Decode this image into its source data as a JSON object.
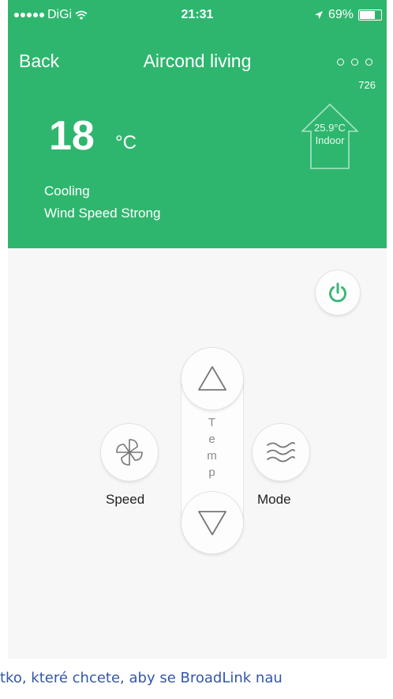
{
  "status_bar": {
    "carrier": "DiGi",
    "time": "21:31",
    "battery": "69%",
    "battery_level": 0.69
  },
  "nav": {
    "back_label": "Back",
    "title": "Aircond living",
    "device_id": "726"
  },
  "temperature": {
    "value": "18",
    "unit": "°C"
  },
  "indoor": {
    "temp": "25.9°C",
    "label": "Indoor"
  },
  "status": {
    "mode": "Cooling",
    "wind": "Wind Speed Strong"
  },
  "controls": {
    "temp_letters": [
      "T",
      "e",
      "m",
      "p"
    ],
    "speed_label": "Speed",
    "mode_label": "Mode"
  },
  "caption": "tko, které chcete, aby se BroadLink nau",
  "colors": {
    "header_green": "#2fb66e",
    "power_green": "#3cb878"
  },
  "icons": [
    "wifi-icon",
    "location-arrow-icon",
    "battery-icon",
    "more-icon",
    "power-icon",
    "arrow-up-icon",
    "arrow-down-icon",
    "fan-icon",
    "wave-icon",
    "house-icon"
  ]
}
